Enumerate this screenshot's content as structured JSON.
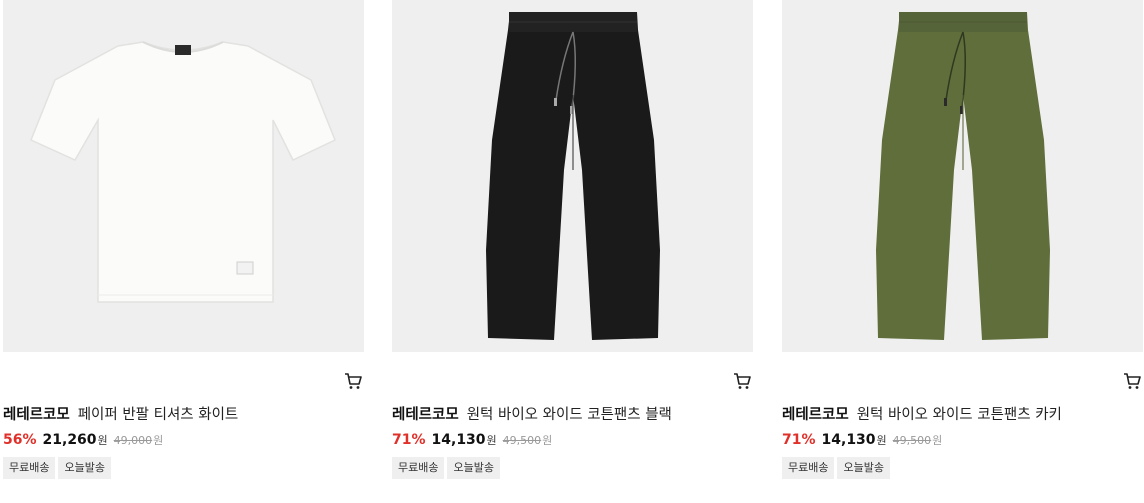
{
  "products": [
    {
      "image": "white-tshirt",
      "brand": "레테르코모",
      "name": "페이퍼 반팔 티셔츠 화이트",
      "discount": "56%",
      "price": "21,260",
      "price_unit": "원",
      "original_price": "49,000",
      "original_unit": "원",
      "tags": [
        "무료배송",
        "오늘발송"
      ]
    },
    {
      "image": "black-wide-pants",
      "brand": "레테르코모",
      "name": "원턱 바이오 와이드 코튼팬츠 블랙",
      "discount": "71%",
      "price": "14,130",
      "price_unit": "원",
      "original_price": "49,500",
      "original_unit": "원",
      "tags": [
        "무료배송",
        "오늘발송"
      ]
    },
    {
      "image": "khaki-wide-pants",
      "brand": "레테르코모",
      "name": "원턱 바이오 와이드 코튼팬츠 카키",
      "discount": "71%",
      "price": "14,130",
      "price_unit": "원",
      "original_price": "49,500",
      "original_unit": "원",
      "tags": [
        "무료배송",
        "오늘발송"
      ]
    }
  ],
  "icons": {
    "cart": "cart-icon"
  },
  "colors": {
    "discount": "#e0302a",
    "thumb_bg": "#efefef",
    "khaki": "#5f6e3a",
    "black": "#1a1a1a"
  }
}
